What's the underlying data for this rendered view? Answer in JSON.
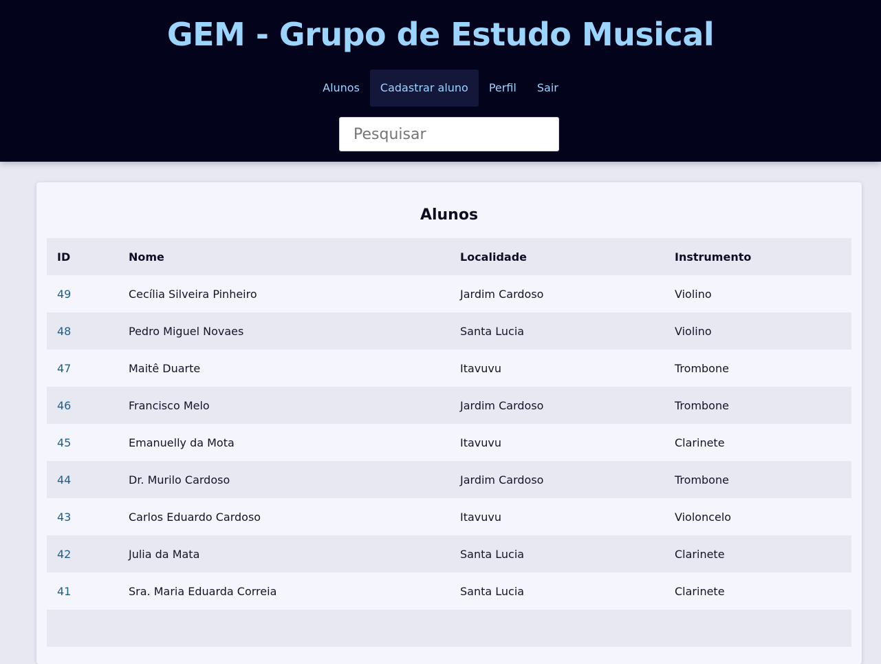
{
  "header": {
    "title": "GEM - Grupo de Estudo Musical",
    "nav": [
      {
        "label": "Alunos",
        "active": false
      },
      {
        "label": "Cadastrar aluno",
        "active": true
      },
      {
        "label": "Perfil",
        "active": false
      },
      {
        "label": "Sair",
        "active": false
      }
    ],
    "search": {
      "placeholder": "Pesquisar",
      "value": ""
    }
  },
  "main": {
    "title": "Alunos",
    "table": {
      "columns": [
        "ID",
        "Nome",
        "Localidade",
        "Instrumento"
      ],
      "rows": [
        {
          "id": "49",
          "nome": "Cecília Silveira Pinheiro",
          "localidade": "Jardim Cardoso",
          "instrumento": "Violino"
        },
        {
          "id": "48",
          "nome": "Pedro Miguel Novaes",
          "localidade": "Santa Lucia",
          "instrumento": "Violino"
        },
        {
          "id": "47",
          "nome": "Maitê Duarte",
          "localidade": "Itavuvu",
          "instrumento": "Trombone"
        },
        {
          "id": "46",
          "nome": "Francisco Melo",
          "localidade": "Jardim Cardoso",
          "instrumento": "Trombone"
        },
        {
          "id": "45",
          "nome": "Emanuelly da Mota",
          "localidade": "Itavuvu",
          "instrumento": "Clarinete"
        },
        {
          "id": "44",
          "nome": "Dr. Murilo Cardoso",
          "localidade": "Jardim Cardoso",
          "instrumento": "Trombone"
        },
        {
          "id": "43",
          "nome": "Carlos Eduardo Cardoso",
          "localidade": "Itavuvu",
          "instrumento": "Violoncelo"
        },
        {
          "id": "42",
          "nome": "Julia da Mata",
          "localidade": "Santa Lucia",
          "instrumento": "Clarinete"
        },
        {
          "id": "41",
          "nome": "Sra. Maria Eduarda Correia",
          "localidade": "Santa Lucia",
          "instrumento": "Clarinete"
        }
      ]
    }
  },
  "colors": {
    "header_bg": "#03041c",
    "accent": "#9bd4fc",
    "link": "#1c5f8e",
    "page_bg": "#e8e8f3",
    "card_bg": "#f5f5fd"
  }
}
